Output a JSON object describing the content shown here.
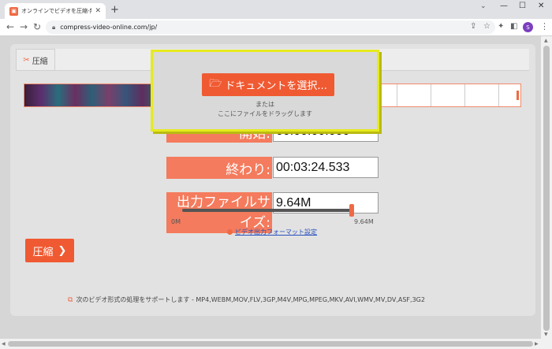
{
  "browser": {
    "tab_title": "オンラインでビデオを圧縮-無料で安全",
    "tab_favicon": "compress-logo",
    "url": "compress-video-online.com/jp/",
    "profile_initial": "S"
  },
  "upload": {
    "select_button": "ドキュメントを選択...",
    "or_text": "または",
    "drag_text": "ここにファイルをドラッグします"
  },
  "tabs": {
    "compress_label": "圧縮"
  },
  "fields": {
    "start_label": "開始:",
    "start_value": "00:00:00.000",
    "end_label": "終わり:",
    "end_value": "00:03:24.533",
    "size_label": "出力ファイルサイズ:",
    "size_value": "9.64M"
  },
  "slider": {
    "min_label": "0M",
    "max_label": "9.64M",
    "value_fraction": 1.0
  },
  "format_link": "ビデオ出力フォーマット設定",
  "compress_button": "圧縮",
  "footer_note": "次のビデオ形式の処理をサポートします - MP4,WEBM,MOV,FLV,3GP,M4V,MPG,MPEG,MKV,AVI,WMV,MV,DV,ASF,3G2",
  "colors": {
    "accent": "#f05a32",
    "label_bg": "#f47b5d",
    "highlight_border": "#e6ea1d"
  }
}
